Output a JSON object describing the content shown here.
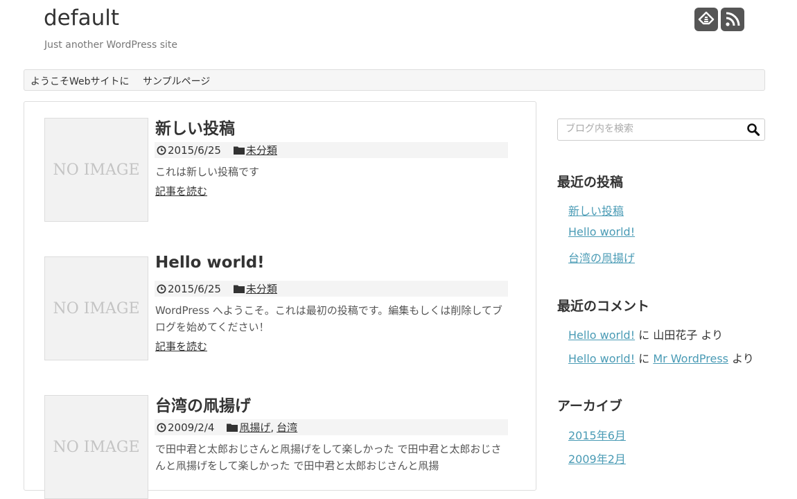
{
  "header": {
    "site_title": "default",
    "tagline": "Just another WordPress site",
    "social": [
      {
        "icon": "feedly-icon"
      },
      {
        "icon": "rss-icon"
      }
    ]
  },
  "nav": {
    "items": [
      "ようこそWebサイトに",
      "サンプルページ"
    ]
  },
  "posts": [
    {
      "thumb": "NO IMAGE",
      "title": "新しい投稿",
      "date": "2015/6/25",
      "categories": [
        "未分類"
      ],
      "excerpt": "これは新しい投稿です",
      "read_more": "記事を読む"
    },
    {
      "thumb": "NO IMAGE",
      "title": "Hello world!",
      "date": "2015/6/25",
      "categories": [
        "未分類"
      ],
      "excerpt": "WordPress へようこそ。これは最初の投稿です。編集もしくは削除してブログを始めてください！",
      "read_more": "記事を読む"
    },
    {
      "thumb": "NO IMAGE",
      "title": "台湾の凧揚げ",
      "date": "2009/2/4",
      "categories": [
        "凧揚げ",
        "台湾"
      ],
      "category_separator": ",",
      "excerpt": "で田中君と太郎おじさんと凧揚げをして楽しかった で田中君と太郎おじさんと凧揚げをして楽しかった で田中君と太郎おじさんと凧揚"
    }
  ],
  "sidebar": {
    "search": {
      "placeholder": "ブログ内を検索"
    },
    "recent_posts": {
      "title": "最近の投稿",
      "items": [
        "新しい投稿",
        "Hello world!",
        "台湾の凧揚げ"
      ]
    },
    "recent_comments": {
      "title": "最近のコメント",
      "items": [
        {
          "post": "Hello world!",
          "on": "に",
          "author": "山田花子",
          "by": "より"
        },
        {
          "post": "Hello world!",
          "on": "に",
          "author": "Mr WordPress",
          "by": "より"
        }
      ]
    },
    "archives": {
      "title": "アーカイブ",
      "items": [
        "2015年6月",
        "2009年2月"
      ]
    }
  },
  "colors": {
    "link": "#4a9bb5",
    "text": "#333333",
    "icon_bg": "#555555"
  }
}
